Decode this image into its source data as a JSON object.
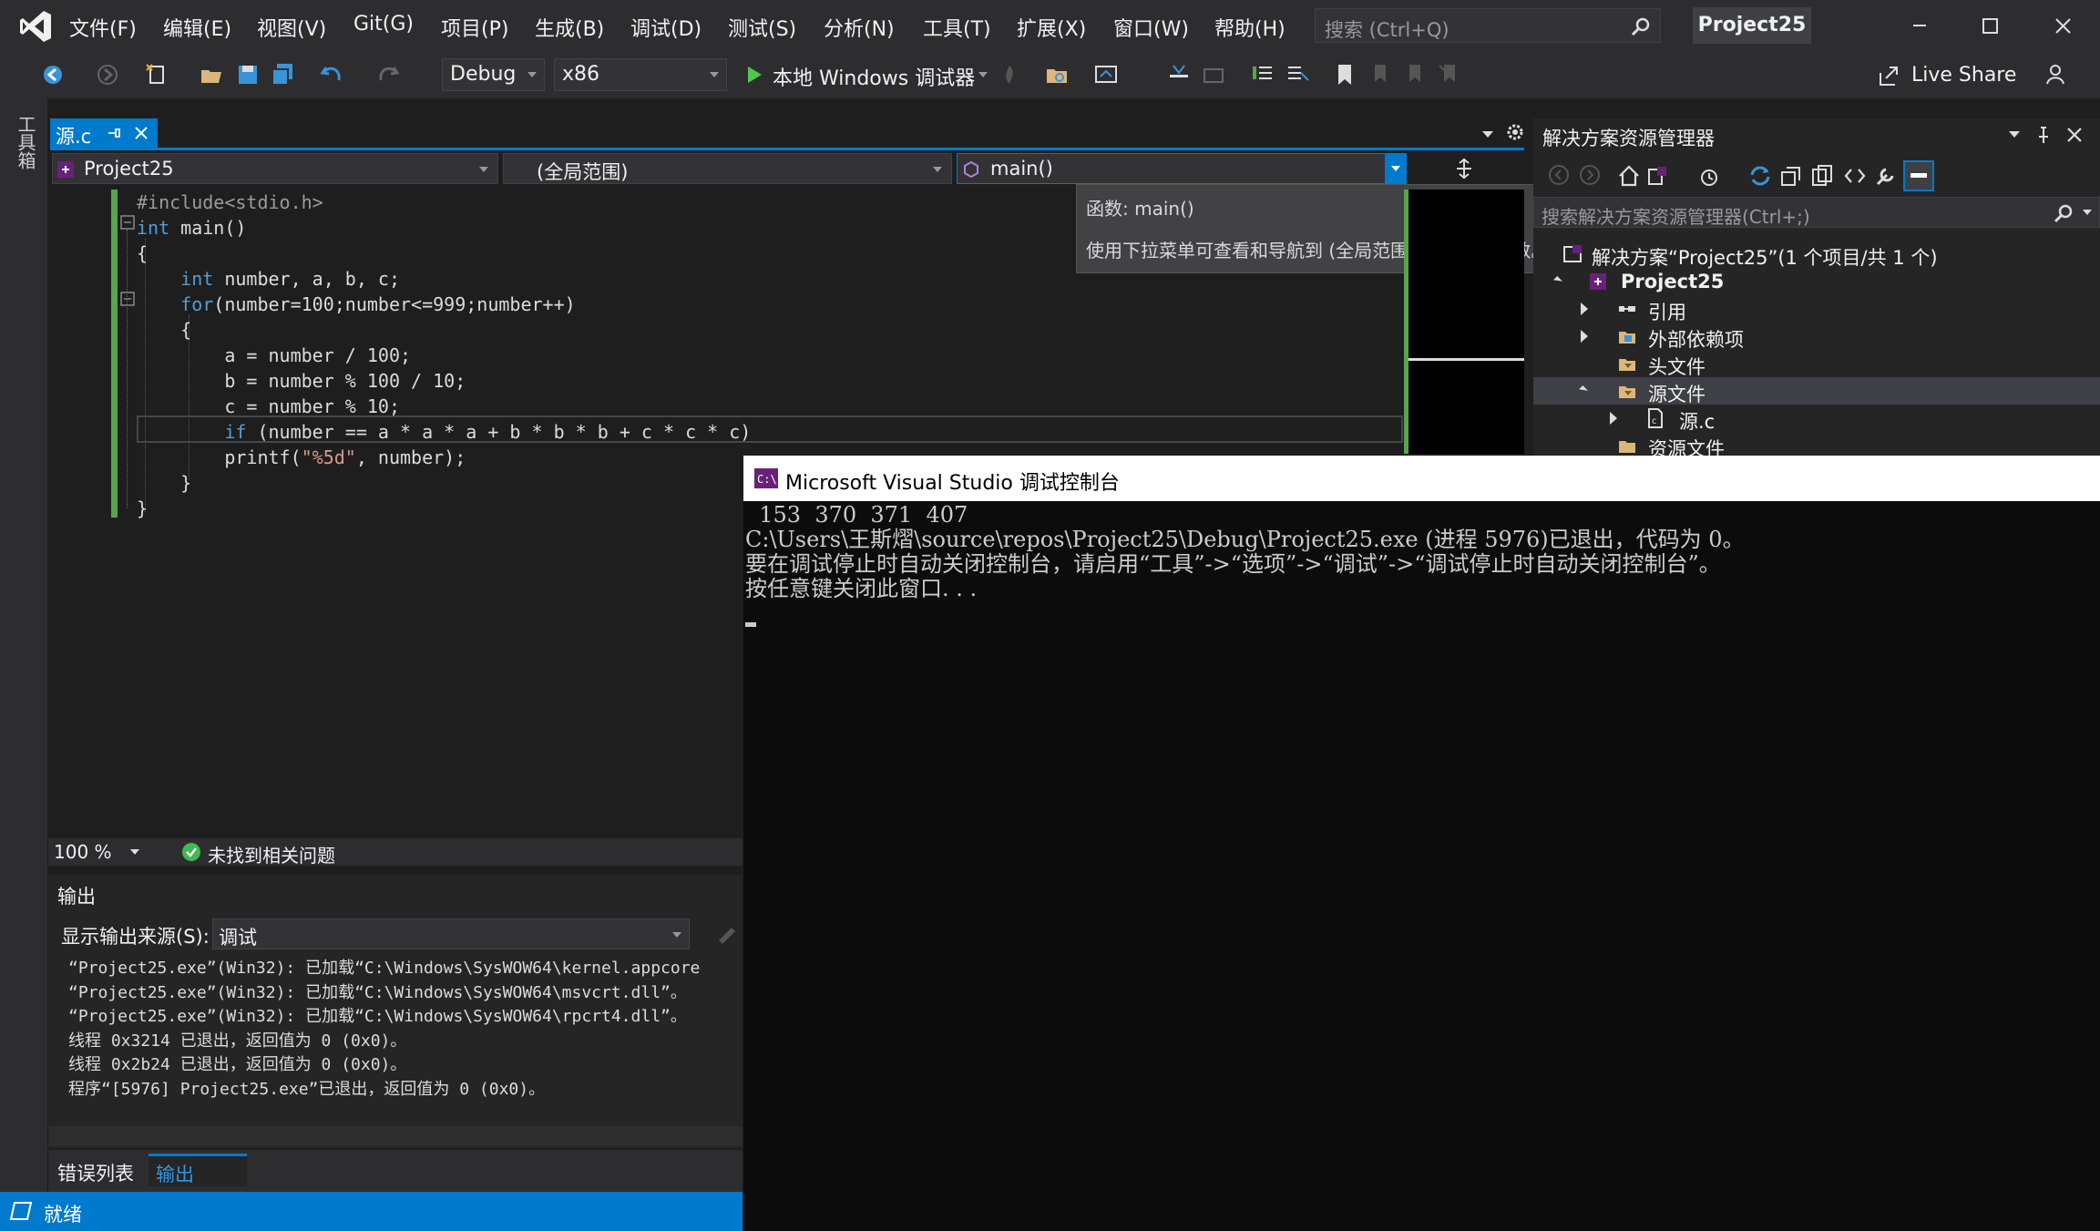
{
  "menu": [
    "文件(F)",
    "编辑(E)",
    "视图(V)",
    "Git(G)",
    "项目(P)",
    "生成(B)",
    "调试(D)",
    "测试(S)",
    "分析(N)",
    "工具(T)",
    "扩展(X)",
    "窗口(W)",
    "帮助(H)"
  ],
  "search": {
    "placeholder": "搜索 (Ctrl+Q)"
  },
  "project_title": "Project25",
  "toolbar": {
    "config": "Debug",
    "platform": "x86",
    "run_label": "本地 Windows 调试器",
    "live_share": "Live Share"
  },
  "toolbox_label": "工具箱",
  "editor": {
    "tab_label": "源.c",
    "nav_project": "Project25",
    "nav_scope": "(全局范围)",
    "nav_function": "main()",
    "tooltip_title": "函数: main()",
    "tooltip_body": "使用下拉菜单可查看和导航到 (全局范围) 中的所有函数。",
    "code_lines": [
      "#include<stdio.h>",
      "int main()",
      "{",
      "    int number, a, b, c;",
      "    for(number=100;number<=999;number++)",
      "    {",
      "        a = number / 100;",
      "        b = number % 100 / 10;",
      "        c = number % 10;",
      "        if (number == a * a * a + b * b * b + c * c * c)",
      "        printf(\"%5d\", number);",
      "    }",
      "}"
    ],
    "zoom": "100 %",
    "issues": "未找到相关问题"
  },
  "output": {
    "title": "输出",
    "source_label": "显示输出来源(S):",
    "source_value": "调试",
    "lines": [
      "“Project25.exe”(Win32): 已加载“C:\\Windows\\SysWOW64\\kernel.appcore",
      "“Project25.exe”(Win32): 已加载“C:\\Windows\\SysWOW64\\msvcrt.dll”。",
      "“Project25.exe”(Win32): 已加载“C:\\Windows\\SysWOW64\\rpcrt4.dll”。",
      "线程 0x3214 已退出，返回值为 0 (0x0)。",
      "线程 0x2b24 已退出，返回值为 0 (0x0)。",
      "程序“[5976] Project25.exe”已退出，返回值为 0 (0x0)。"
    ],
    "tabs": [
      "错误列表",
      "输出"
    ]
  },
  "status": {
    "text": "就绪"
  },
  "solution_explorer": {
    "title": "解决方案资源管理器",
    "search_placeholder": "搜索解决方案资源管理器(Ctrl+;)",
    "items": [
      "解决方案“Project25”(1 个项目/共 1 个)",
      "Project25",
      "引用",
      "外部依赖项",
      "头文件",
      "源文件",
      "源.c",
      "资源文件"
    ]
  },
  "console": {
    "title": "Microsoft Visual Studio 调试控制台",
    "lines": [
      "  153  370  371  407",
      "C:\\Users\\王斯熠\\source\\repos\\Project25\\Debug\\Project25.exe (进程 5976)已退出，代码为 0。",
      "要在调试停止时自动关闭控制台，请启用“工具”->“选项”->“调试”->“调试停止时自动关闭控制台”。",
      "按任意键关闭此窗口. . ."
    ]
  },
  "colors": {
    "accent": "#007acc",
    "chrome": "#2d2d30",
    "editor_bg": "#1e1e1e",
    "keyword": "#569cd6",
    "string": "#d69d85",
    "console_bg": "#0c0c0c"
  }
}
